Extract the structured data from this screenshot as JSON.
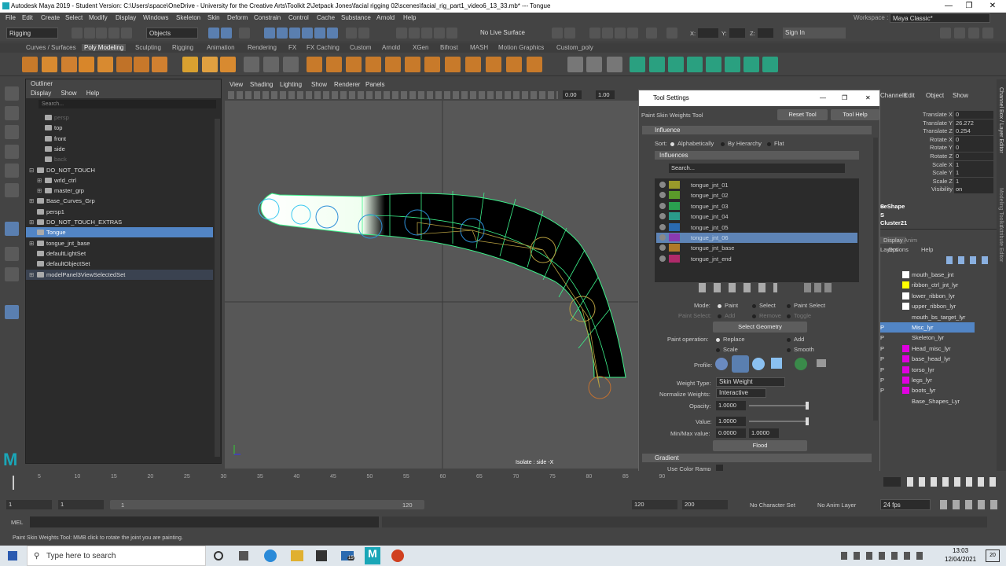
{
  "window": {
    "title": "Autodesk Maya 2019 - Student Version: C:\\Users\\space\\OneDrive - University for the Creative Arts\\Toolkit 2\\Jetpack Jones\\facial rigging 02\\scenes\\facial_rig_part1_video6_13_33.mb*   ---   Tongue",
    "min": "—",
    "max": "❐",
    "close": "✕"
  },
  "menus": [
    "File",
    "Edit",
    "Create",
    "Select",
    "Modify",
    "Display",
    "Windows",
    "Skeleton",
    "Skin",
    "Deform",
    "Constrain",
    "Control",
    "Cache",
    "Substance",
    "Arnold",
    "Help"
  ],
  "workspace": {
    "label": "Workspace :",
    "value": "Maya Classic*"
  },
  "status": {
    "menuset": "Rigging",
    "objects": "Objects",
    "live": "No Live Surface",
    "x": "X:",
    "y": "Y:",
    "z": "Z:",
    "signin": "Sign In"
  },
  "shelf_tabs": [
    "Curves / Surfaces",
    "Poly Modeling",
    "Sculpting",
    "Rigging",
    "Animation",
    "Rendering",
    "FX",
    "FX Caching",
    "Custom",
    "Arnold",
    "XGen",
    "Bifrost",
    "MASH",
    "Motion Graphics",
    "Custom_poly"
  ],
  "shelf_active": "Poly Modeling",
  "outliner": {
    "title": "Outliner",
    "menu": [
      "Display",
      "Show",
      "Help"
    ],
    "search": "Search...",
    "rows": [
      {
        "label": "persp",
        "indent": 1,
        "dim": true
      },
      {
        "label": "top",
        "indent": 1
      },
      {
        "label": "front",
        "indent": 1
      },
      {
        "label": "side",
        "indent": 1
      },
      {
        "label": "back",
        "indent": 1,
        "dim": true
      },
      {
        "label": "DO_NOT_TOUCH",
        "indent": 0,
        "exp": "⊟"
      },
      {
        "label": "wrld_ctrl",
        "indent": 1,
        "exp": "⊞"
      },
      {
        "label": "master_grp",
        "indent": 1,
        "exp": "⊞"
      },
      {
        "label": "Base_Curves_Grp",
        "indent": 0,
        "exp": "⊞"
      },
      {
        "label": "persp1",
        "indent": 0
      },
      {
        "label": "DO_NOT_TOUCH_EXTRAS",
        "indent": 0,
        "exp": "⊞"
      },
      {
        "label": "Tongue",
        "indent": 0,
        "sel": true
      },
      {
        "label": "tongue_jnt_base",
        "indent": 0,
        "exp": "⊞"
      },
      {
        "label": "defaultLightSet",
        "indent": 0
      },
      {
        "label": "defaultObjectSet",
        "indent": 0
      },
      {
        "label": "modelPanel3ViewSelectedSet",
        "indent": 0,
        "exp": "⊞",
        "hl": true
      }
    ]
  },
  "viewport": {
    "menu": [
      "View",
      "Shading",
      "Lighting",
      "Show",
      "Renderer",
      "Panels"
    ],
    "near": "0.00",
    "far": "1.00",
    "hud": "Isolate : side -X"
  },
  "tool_settings": {
    "title": "Tool Settings",
    "tool": "Paint Skin Weights Tool",
    "reset": "Reset Tool",
    "help": "Tool Help",
    "influence_frame": "Influence",
    "sort_label": "Sort:",
    "sort_opts": [
      "Alphabetically",
      "By Hierarchy",
      "Flat"
    ],
    "influences_label": "Influences",
    "search": "Search...",
    "influences": [
      {
        "name": "tongue_jnt_01",
        "color": "#9a9a2a"
      },
      {
        "name": "tongue_jnt_02",
        "color": "#5a9a2a"
      },
      {
        "name": "tongue_jnt_03",
        "color": "#2aa050"
      },
      {
        "name": "tongue_jnt_04",
        "color": "#2a9a8a"
      },
      {
        "name": "tongue_jnt_05",
        "color": "#2a6ab0"
      },
      {
        "name": "tongue_jnt_06",
        "color": "#8a3ab0",
        "sel": true
      },
      {
        "name": "tongue_jnt_base",
        "color": "#b07a2a"
      },
      {
        "name": "tongue_jnt_end",
        "color": "#b02a6a"
      }
    ],
    "mode_label": "Mode:",
    "mode_opts": [
      "Paint",
      "Select",
      "Paint Select"
    ],
    "paint_select_label": "Paint Select:",
    "paint_select_opts": [
      "Add",
      "Remove",
      "Toggle"
    ],
    "select_geometry": "Select Geometry",
    "paint_op_label": "Paint operation:",
    "paint_ops": [
      "Replace",
      "Add",
      "Scale",
      "Smooth"
    ],
    "profile_label": "Profile:",
    "weight_type_label": "Weight Type:",
    "weight_type": "Skin Weight",
    "normalize_label": "Normalize Weights:",
    "normalize": "Interactive",
    "opacity_label": "Opacity:",
    "opacity": "1.0000",
    "value_label": "Value:",
    "value": "1.0000",
    "minmax_label": "Min/Max value:",
    "min": "0.0000",
    "max": "1.0000",
    "flood": "Flood",
    "gradient_frame": "Gradient",
    "color_ramp": "Use Color Ramp"
  },
  "channel_box": {
    "menu": [
      "Channels",
      "Edit",
      "Object",
      "Show"
    ],
    "attrs": [
      {
        "n": "Translate X",
        "v": "0"
      },
      {
        "n": "Translate Y",
        "v": "26.272"
      },
      {
        "n": "Translate Z",
        "v": "0.254"
      },
      {
        "n": "Rotate X",
        "v": "0"
      },
      {
        "n": "Rotate Y",
        "v": "0"
      },
      {
        "n": "Rotate Z",
        "v": "0"
      },
      {
        "n": "Scale X",
        "v": "1"
      },
      {
        "n": "Scale Y",
        "v": "1"
      },
      {
        "n": "Scale Z",
        "v": "1"
      },
      {
        "n": "Visibility",
        "v": "on"
      }
    ],
    "shape": "ueShape",
    "s1": "S",
    "s2": "S",
    "cluster": "Cluster21",
    "layer_tabs": [
      "Display",
      "Anim"
    ],
    "layer_menu": [
      "Layers",
      "Options",
      "Help"
    ],
    "layers": [
      {
        "name": "mouth_base_jnt",
        "color": "#ffffff"
      },
      {
        "name": "ribbon_ctrl_jnt_lyr",
        "color": "#ffff00"
      },
      {
        "name": "lower_ribbon_lyr",
        "color": "#ffffff"
      },
      {
        "name": "upper_ribbon_lyr",
        "color": "#ffffff"
      },
      {
        "name": "mouth_bs_target_lyr",
        "color": "#444444"
      },
      {
        "name": "Misc_lyr",
        "color": "#5285c5",
        "sel": true,
        "p": "P"
      },
      {
        "name": "Skeleton_lyr",
        "color": "#444444",
        "p": "P"
      },
      {
        "name": "Head_misc_lyr",
        "color": "#e000e0",
        "p": "P"
      },
      {
        "name": "base_head_lyr",
        "color": "#e000e0",
        "p": "P"
      },
      {
        "name": "torso_lyr",
        "color": "#e000e0",
        "p": "P"
      },
      {
        "name": "legs_lyr",
        "color": "#e000e0",
        "p": "P"
      },
      {
        "name": "boots_lyr",
        "color": "#e000e0",
        "p": "P"
      },
      {
        "name": "Base_Shapes_Lyr",
        "color": "#444444"
      }
    ]
  },
  "side_tabs": [
    "Channel Box / Layer Editor",
    "Modeling Toolkit",
    "Attribute Editor"
  ],
  "timeline": {
    "ticks": [
      "5",
      "10",
      "15",
      "20",
      "25",
      "30",
      "35",
      "40",
      "45",
      "50",
      "55",
      "60",
      "65",
      "70",
      "75",
      "80",
      "85",
      "90"
    ],
    "start": "1",
    "start2": "1",
    "range_start": "1",
    "range_end": "120",
    "end": "120",
    "end2": "200",
    "char_set": "No Character Set",
    "anim_layer": "No Anim Layer",
    "fps": "24 fps"
  },
  "mel": {
    "label": "MEL"
  },
  "help_line": "Paint Skin Weights Tool: MMB click to rotate the joint you are painting.",
  "taskbar": {
    "search": "Type here to search",
    "time": "13:03",
    "date": "12/04/2021",
    "notif": "20",
    "mail_badge": "15"
  }
}
